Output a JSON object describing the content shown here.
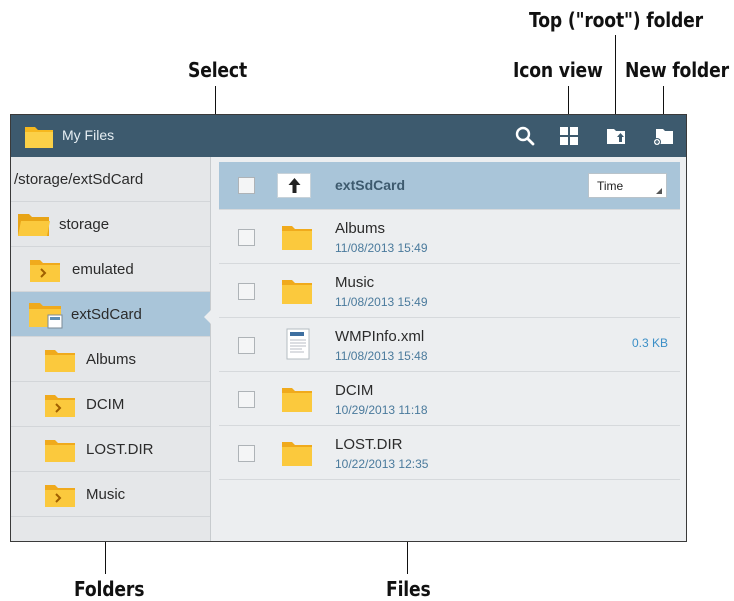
{
  "callouts": {
    "top_root": "Top (\"root\") folder",
    "icon_view": "Icon view",
    "new_folder": "New folder",
    "select": "Select",
    "folders": "Folders",
    "files": "Files"
  },
  "titlebar": {
    "title": "My Files",
    "icons": [
      "search-icon",
      "icon-view-icon",
      "top-root-folder-icon",
      "new-folder-icon"
    ],
    "color": "#3d5a6e"
  },
  "sidebar": {
    "path": "/storage/extSdCard",
    "items": [
      {
        "label": "storage",
        "icon": "folder-open-icon"
      },
      {
        "label": "emulated",
        "icon": "folder-arrow-icon"
      },
      {
        "label": "extSdCard",
        "icon": "sdcard-folder-icon",
        "selected": true
      },
      {
        "label": "Albums",
        "icon": "folder-icon"
      },
      {
        "label": "DCIM",
        "icon": "folder-arrow-icon"
      },
      {
        "label": "LOST.DIR",
        "icon": "folder-icon"
      },
      {
        "label": "Music",
        "icon": "folder-arrow-icon"
      }
    ]
  },
  "files": {
    "current_folder": "extSdCard",
    "sort_label": "Time",
    "items": [
      {
        "name": "Albums",
        "date": "11/08/2013 15:49",
        "size": "",
        "icon": "folder-icon"
      },
      {
        "name": "Music",
        "date": "11/08/2013 15:49",
        "size": "",
        "icon": "folder-icon"
      },
      {
        "name": "WMPInfo.xml",
        "date": "11/08/2013 15:48",
        "size": "0.3 KB",
        "icon": "html-file-icon"
      },
      {
        "name": "DCIM",
        "date": "10/29/2013 11:18",
        "size": "",
        "icon": "folder-icon"
      },
      {
        "name": "LOST.DIR",
        "date": "10/22/2013 12:35",
        "size": "",
        "icon": "folder-icon"
      }
    ]
  },
  "colors": {
    "selected": "#a9c5d9",
    "folder": "#f6b81e",
    "date": "#4a7a9c",
    "size": "#3b8fc7"
  }
}
